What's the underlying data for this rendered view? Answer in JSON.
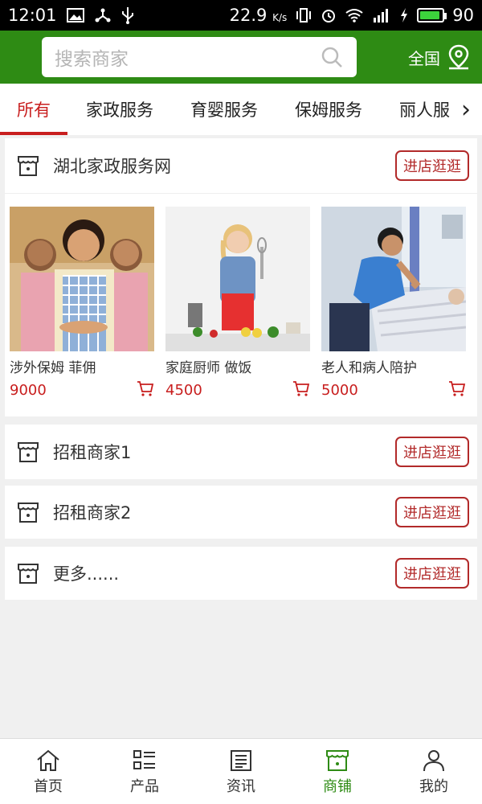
{
  "status": {
    "time": "12:01",
    "speed": "22.9",
    "speed_unit": "K/s",
    "battery": "90",
    "battery_level": 0.9,
    "left_icons": [
      "image-icon",
      "share-icon",
      "usb-icon"
    ],
    "right_icons": [
      "vibrate-icon",
      "alarm-icon",
      "wifi-icon",
      "signal-icon",
      "charging-icon"
    ]
  },
  "header": {
    "search_placeholder": "搜索商家",
    "region": "全国",
    "bg_color": "#2e8b14"
  },
  "tabs": [
    {
      "label": "所有",
      "active": true
    },
    {
      "label": "家政服务",
      "active": false
    },
    {
      "label": "育婴服务",
      "active": false
    },
    {
      "label": "保姆服务",
      "active": false
    },
    {
      "label": "丽人服务",
      "active": false
    }
  ],
  "stores": [
    {
      "name": "湖北家政服务网",
      "button": "进店逛逛",
      "products": [
        {
          "name": "涉外保姆 菲佣",
          "price": "9000"
        },
        {
          "name": "家庭厨师 做饭",
          "price": "4500"
        },
        {
          "name": "老人和病人陪护",
          "price": "5000"
        }
      ]
    },
    {
      "name": "招租商家1",
      "button": "进店逛逛"
    },
    {
      "name": "招租商家2",
      "button": "进店逛逛"
    },
    {
      "name": "更多......",
      "button": "进店逛逛"
    }
  ],
  "bottom_nav": [
    {
      "label": "首页",
      "icon": "home-icon",
      "active": false
    },
    {
      "label": "产品",
      "icon": "list-icon",
      "active": false
    },
    {
      "label": "资讯",
      "icon": "news-icon",
      "active": false
    },
    {
      "label": "商铺",
      "icon": "shop-icon",
      "active": true
    },
    {
      "label": "我的",
      "icon": "user-icon",
      "active": false
    }
  ],
  "accent_color": "#c81e1e"
}
